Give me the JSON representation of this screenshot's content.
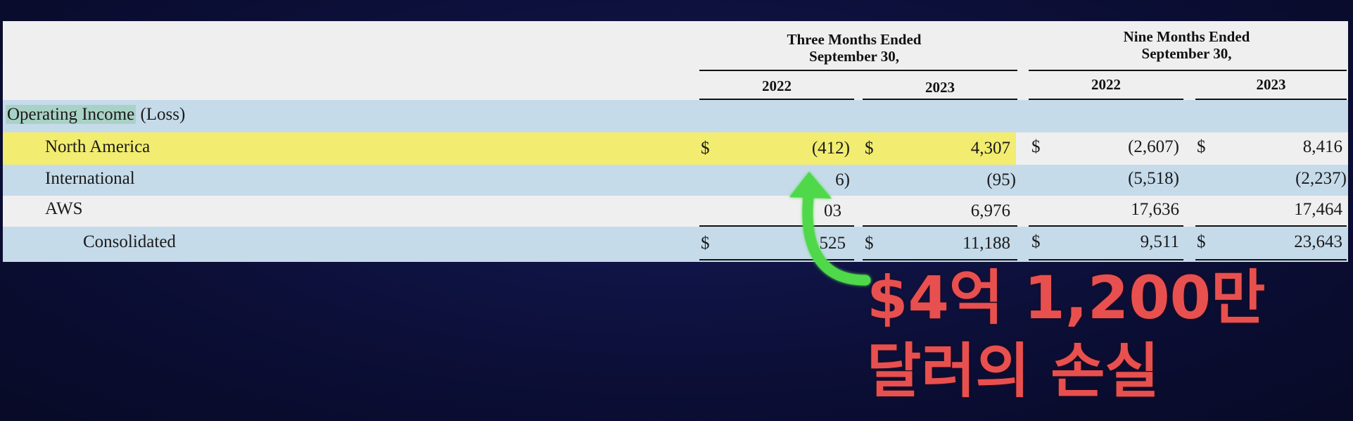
{
  "table": {
    "header_groups": [
      {
        "line1": "Three Months Ended",
        "line2": "September 30,"
      },
      {
        "line1": "Nine Months Ended",
        "line2": "September 30,"
      }
    ],
    "years": [
      "2022",
      "2023",
      "2022",
      "2023"
    ],
    "section_label": "Operating Income",
    "section_label_suffix": "(Loss)",
    "currency_symbol": "$",
    "rows": [
      {
        "label": "North America",
        "values": [
          "(412)",
          "4,307",
          "(2,607)",
          "8,416"
        ]
      },
      {
        "label": "International",
        "values": [
          "6)",
          "(95)",
          "(5,518)",
          "(2,237)"
        ]
      },
      {
        "label": "AWS",
        "values": [
          "03",
          "6,976",
          "17,636",
          "17,464"
        ]
      },
      {
        "label": "Consolidated",
        "values": [
          "525",
          "11,188",
          "9,511",
          "23,643"
        ]
      }
    ]
  },
  "callout": {
    "line1": "$4억 1,200만",
    "line2": "달러의 손실",
    "color": "#e85050",
    "arrow_color": "#4fd84a"
  },
  "colors": {
    "highlight_yellow": "#f2ec70",
    "band_blue": "#c6dbea",
    "background": "#0c0f38"
  }
}
